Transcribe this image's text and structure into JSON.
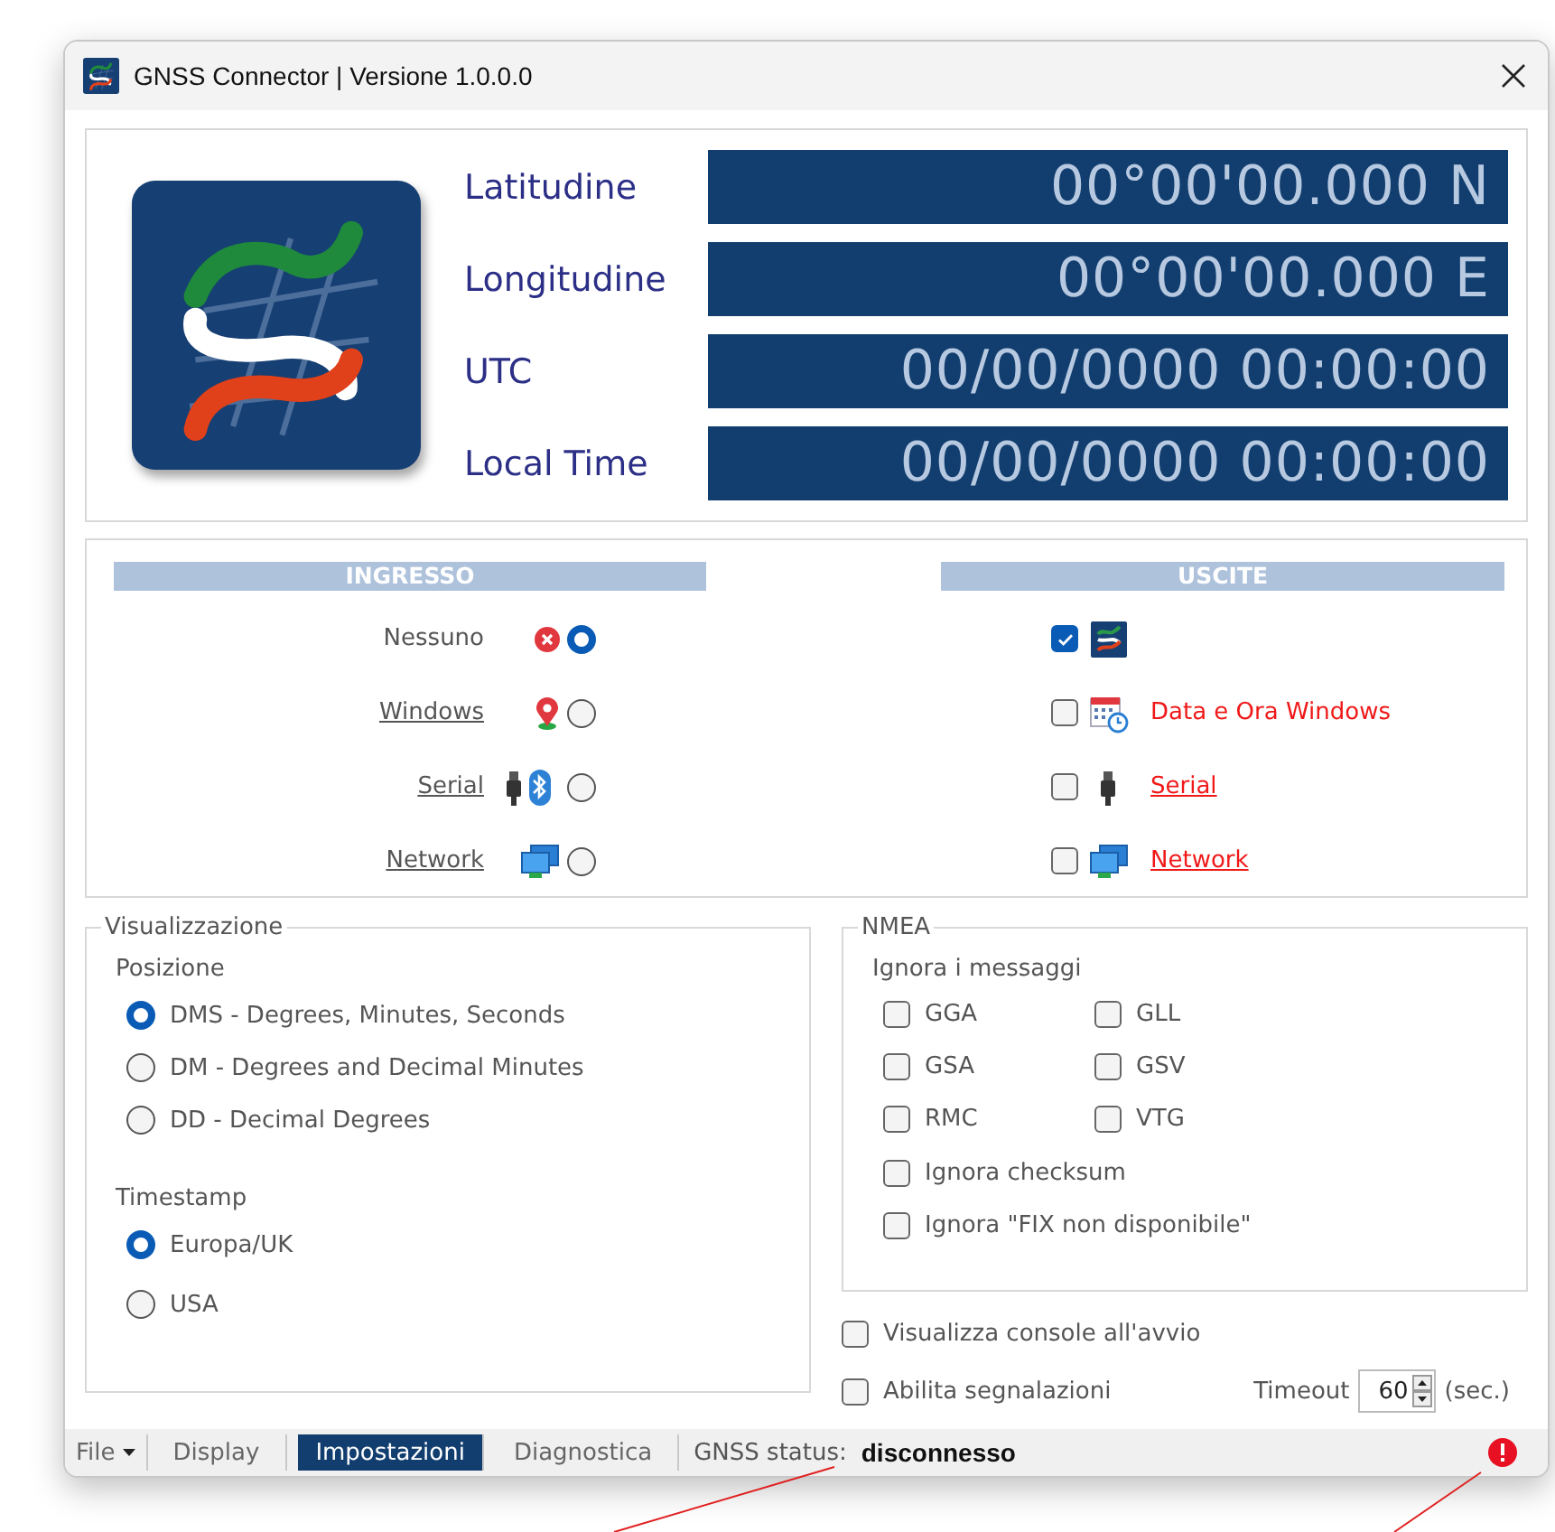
{
  "window": {
    "title": "GNSS Connector | Versione 1.0.0.0"
  },
  "readouts": [
    {
      "label": "Latitudine",
      "value": "00°00'00.000 N"
    },
    {
      "label": "Longitudine",
      "value": "00°00'00.000 E"
    },
    {
      "label": "UTC",
      "value": "00/00/0000 00:00:00"
    },
    {
      "label": "Local Time",
      "value": "00/00/0000 00:00:00"
    }
  ],
  "inputs": {
    "title": "INGRESSO",
    "items": [
      {
        "label": "Nessuno",
        "kind": "none",
        "link": false,
        "selected": true
      },
      {
        "label": "Windows",
        "kind": "location",
        "link": true,
        "selected": false
      },
      {
        "label": "Serial",
        "kind": "serial",
        "link": true,
        "selected": false
      },
      {
        "label": "Network",
        "kind": "network",
        "link": true,
        "selected": false
      }
    ]
  },
  "outputs": {
    "title": "USCITE",
    "items": [
      {
        "kind": "display",
        "checked": true
      },
      {
        "kind": "calendar",
        "label": "Data e Ora Windows",
        "link": false,
        "checked": false
      },
      {
        "kind": "serial",
        "label": "Serial",
        "link": true,
        "checked": false
      },
      {
        "kind": "network",
        "label": "Network",
        "link": true,
        "checked": false
      }
    ]
  },
  "display_settings": {
    "title": "Visualizzazione",
    "groups": [
      {
        "label": "Posizione",
        "options": [
          {
            "label": "DMS - Degrees, Minutes, Seconds",
            "selected": true
          },
          {
            "label": "DM - Degrees and Decimal Minutes",
            "selected": false
          },
          {
            "label": "DD - Decimal Degrees",
            "selected": false
          }
        ]
      },
      {
        "label": "Timestamp",
        "options": [
          {
            "label": "Europa/UK",
            "selected": true
          },
          {
            "label": "USA",
            "selected": false
          }
        ]
      }
    ]
  },
  "nmea": {
    "title": "NMEA",
    "subtitle": "Ignora i messaggi",
    "messages": [
      {
        "label": "GGA",
        "checked": false
      },
      {
        "label": "GLL",
        "checked": false
      },
      {
        "label": "GSA",
        "checked": false
      },
      {
        "label": "GSV",
        "checked": false
      },
      {
        "label": "RMC",
        "checked": false
      },
      {
        "label": "VTG",
        "checked": false
      }
    ],
    "options": [
      {
        "label": "Ignora checksum",
        "checked": false
      },
      {
        "label": "Ignora \"FIX non disponibile\"",
        "checked": false
      }
    ]
  },
  "startup_options": [
    {
      "label": "Visualizza console all'avvio",
      "checked": false
    },
    {
      "label": "Abilita segnalazioni",
      "checked": false
    }
  ],
  "timeout": {
    "label": "Timeout",
    "value": "60",
    "unit": "(sec.)"
  },
  "status_bar": {
    "tabs": [
      {
        "label": "File",
        "kind": "dropdown",
        "selected": false
      },
      {
        "label": "Display",
        "kind": "tab",
        "selected": false
      },
      {
        "label": "Impostazioni",
        "kind": "tab",
        "selected": true
      },
      {
        "label": "Diagnostica",
        "kind": "tab",
        "selected": false
      }
    ],
    "status_label": "GNSS status:",
    "status_value": "disconnesso",
    "alert": true
  }
}
